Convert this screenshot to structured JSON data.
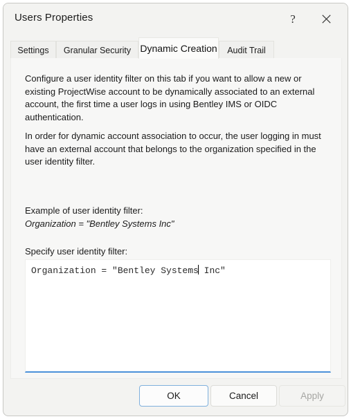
{
  "window": {
    "title": "Users Properties",
    "help_icon": "question-mark-icon",
    "close_icon": "close-icon",
    "accent_color": "#4a90d9"
  },
  "tabs": [
    {
      "label": "Settings",
      "active": false
    },
    {
      "label": "Granular Security",
      "active": false
    },
    {
      "label": "Dynamic Creation",
      "active": true
    },
    {
      "label": "Audit Trail",
      "active": false
    }
  ],
  "content": {
    "paragraph1": "Configure a user identity filter on this tab if you want to allow a new or existing ProjectWise account to be dynamically associated to an external account, the first time a user logs in using Bentley IMS or OIDC authentication.",
    "paragraph2": "In order for dynamic account association to occur, the user logging in must have an external account that belongs to the organization specified in the user identity filter.",
    "example_label": "Example of user identity filter:",
    "example_value": "Organization = \"Bentley Systems Inc\"",
    "specify_label": "Specify user identity filter:",
    "filter_input": {
      "value_before_caret": "Organization = \"Bentley Systems",
      "value_after_caret": " Inc\"",
      "full_value": "Organization = \"Bentley Systems Inc\""
    }
  },
  "footer": {
    "ok_label": "OK",
    "cancel_label": "Cancel",
    "apply_label": "Apply",
    "apply_enabled": false
  }
}
